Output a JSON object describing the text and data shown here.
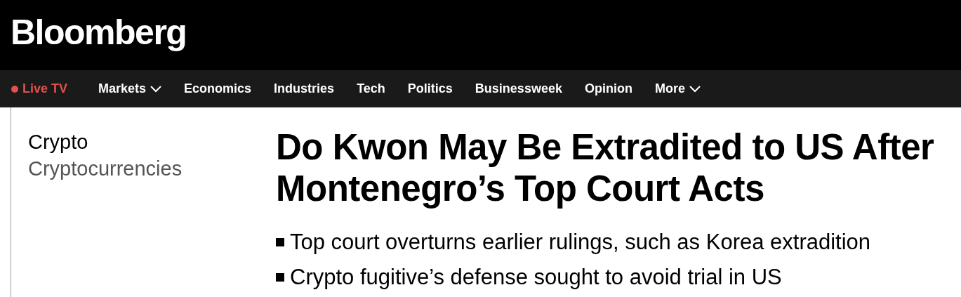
{
  "logo": "Bloomberg",
  "nav": [
    {
      "label": "Live TV",
      "kind": "live"
    },
    {
      "label": "Markets",
      "kind": "menu"
    },
    {
      "label": "Economics",
      "kind": "link"
    },
    {
      "label": "Industries",
      "kind": "link"
    },
    {
      "label": "Tech",
      "kind": "link"
    },
    {
      "label": "Politics",
      "kind": "link"
    },
    {
      "label": "Businessweek",
      "kind": "link"
    },
    {
      "label": "Opinion",
      "kind": "link"
    },
    {
      "label": "More",
      "kind": "menu"
    }
  ],
  "section": {
    "primary": "Crypto",
    "secondary": "Cryptocurrencies"
  },
  "headline": "Do Kwon May Be Extradited to US After Montenegro’s Top Court Acts",
  "bullets": [
    "Top court overturns earlier rulings, such as Korea extradition",
    "Crypto fugitive’s defense sought to avoid trial in US"
  ]
}
